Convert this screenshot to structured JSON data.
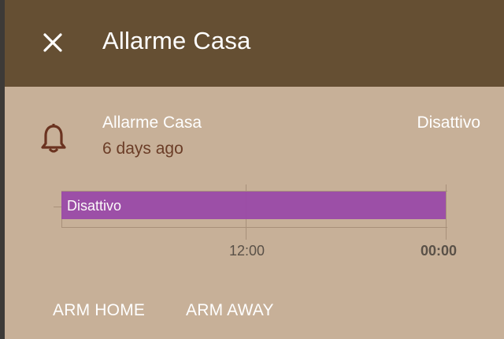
{
  "dialog": {
    "title": "Allarme Casa",
    "close_icon": "close-icon"
  },
  "entity": {
    "icon": "bell-icon",
    "name": "Allarme Casa",
    "last_changed": "6 days ago",
    "state": "Disattivo"
  },
  "timeline": {
    "bar_label": "Disattivo",
    "bar_color": "#9a4aa8",
    "ticks": [
      "12:00",
      "00:00"
    ]
  },
  "actions": {
    "arm_home": "ARM HOME",
    "arm_away": "ARM AWAY"
  },
  "colors": {
    "header": "#654f33",
    "background": "#c7b098",
    "secondary_text": "#6b3d27"
  }
}
